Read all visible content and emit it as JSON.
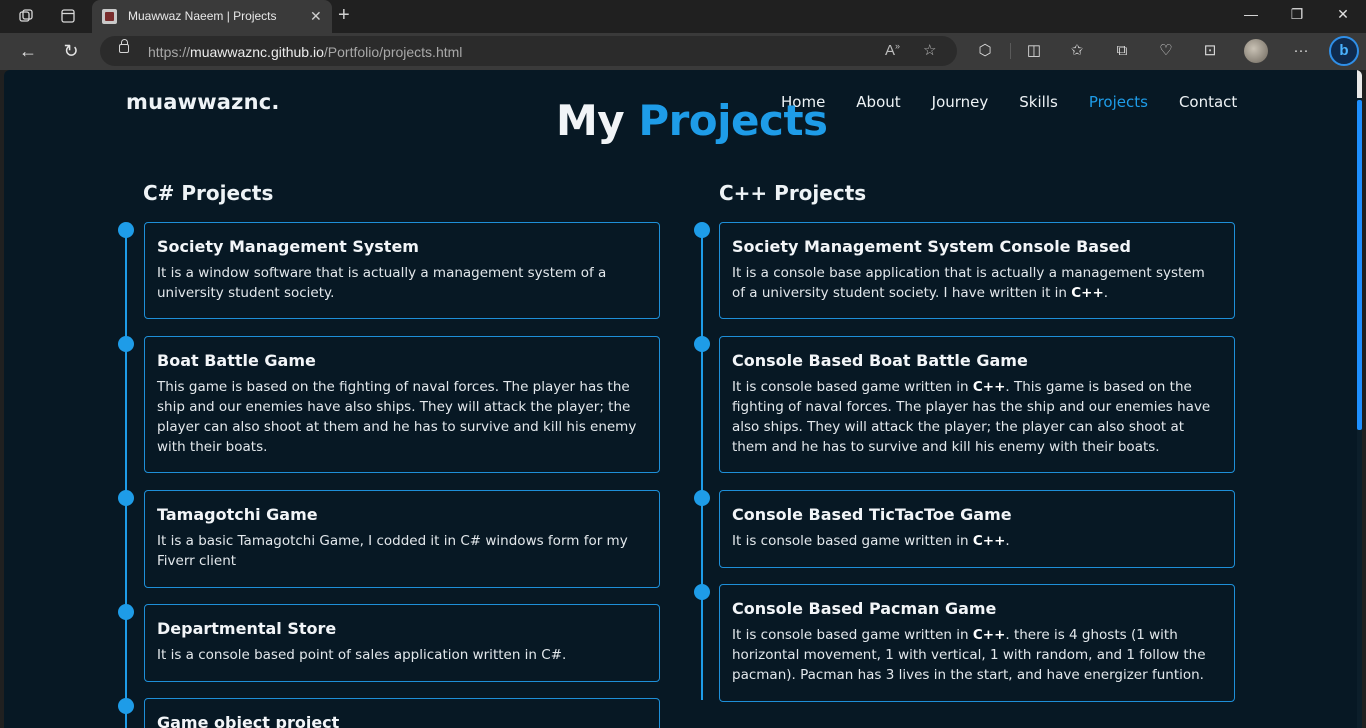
{
  "browser": {
    "tab_title": "Muawwaz Naeem | Projects",
    "url_prefix": "https://",
    "url_host": "muawwaznc.github.io",
    "url_path": "/Portfolio/projects.html"
  },
  "site": {
    "logo": "muawwaznc.",
    "nav": [
      "Home",
      "About",
      "Journey",
      "Skills",
      "Projects",
      "Contact"
    ],
    "active_nav": "Projects"
  },
  "page": {
    "title_part1": "My",
    "title_part2": "Projects"
  },
  "columns": {
    "csharp": {
      "heading": "C# Projects",
      "projects": [
        {
          "title": "Society Management System",
          "description": "It is a window software that is actually a management system of a university student society."
        },
        {
          "title": "Boat Battle Game",
          "description": "This game is based on the fighting of naval forces. The player has the ship and our enemies have also ships. They will attack the player; the player can also shoot at them and he has to survive and kill his enemy with their boats."
        },
        {
          "title": "Tamagotchi Game",
          "description": "It is a basic Tamagotchi Game, I codded it in C# windows form for my Fiverr client"
        },
        {
          "title": "Departmental Store",
          "description": "It is a console based point of sales application written in C#."
        },
        {
          "title": "Game object project",
          "description": ""
        }
      ]
    },
    "cpp": {
      "heading": "C++ Projects",
      "projects": [
        {
          "title": "Society Management System Console Based",
          "desc_before": "It is a console base application that is actually a management system of a university student society. I have written it in ",
          "desc_bold": "C++",
          "desc_after": "."
        },
        {
          "title": "Console Based Boat Battle Game",
          "desc_before": "It is console based game written in ",
          "desc_bold": "C++",
          "desc_after": ". This game is based on the fighting of naval forces. The player has the ship and our enemies have also ships. They will attack the player; the player can also shoot at them and he has to survive and kill his enemy with their boats."
        },
        {
          "title": "Console Based TicTacToe Game",
          "desc_before": "It is console based game written in ",
          "desc_bold": "C++",
          "desc_after": "."
        },
        {
          "title": "Console Based Pacman Game",
          "desc_before": "It is console based game written in ",
          "desc_bold": "C++",
          "desc_after": ". there is 4 ghosts (1 with horizontal movement, 1 with vertical, 1 with random, and 1 follow the pacman). Pacman has 3 lives in the start, and have energizer funtion."
        }
      ]
    }
  },
  "colors": {
    "background": "#071824",
    "accent": "#1e9ce8",
    "text": "#eef3f6"
  }
}
